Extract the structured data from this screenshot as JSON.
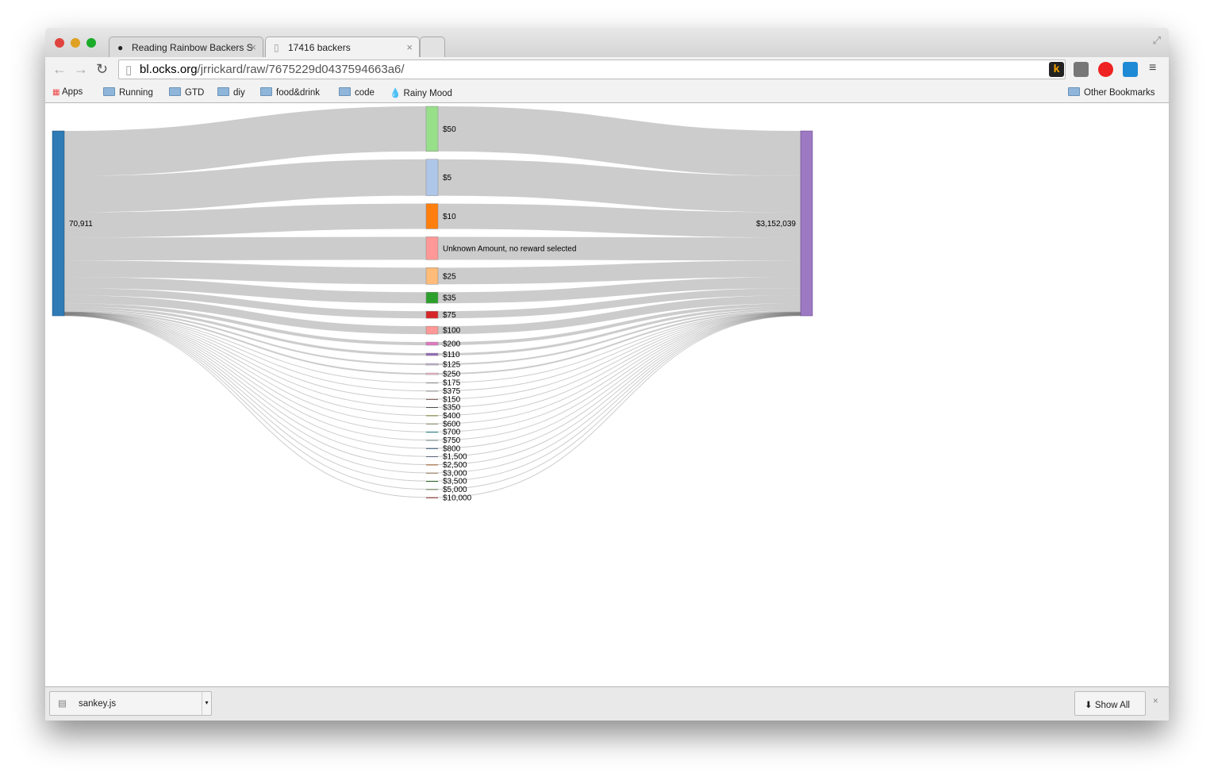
{
  "browser": {
    "tabs": [
      {
        "label": "Reading Rainbow Backers S",
        "icon": "github-icon"
      },
      {
        "label": "17416 backers",
        "icon": "page-icon"
      }
    ],
    "url_host": "bl.ocks.org",
    "url_path": "/jrrickard/raw/7675229d0437594663a6/",
    "bookmarks": [
      "Apps",
      "Running",
      "GTD",
      "diy",
      "food&drink",
      "code",
      "Rainy Mood"
    ],
    "other_bookmarks": "Other Bookmarks",
    "download": {
      "file": "sankey.js",
      "show_all": "Show All"
    }
  },
  "colors": {
    "link": "#cccccc",
    "source_node": "#2f7bb6",
    "target_node": "#9d79c3"
  },
  "chart_data": {
    "type": "sankey",
    "source": {
      "label": "70,911"
    },
    "target": {
      "label": "$3,152,039"
    },
    "nodes": [
      {
        "label": "$50",
        "value": 17270,
        "color": "#98df8a"
      },
      {
        "label": "$5",
        "value": 13940,
        "color": "#aec7e8"
      },
      {
        "label": "$10",
        "value": 9700,
        "color": "#ff7f0e"
      },
      {
        "label": "Unknown Amount, no reward selected",
        "value": 8790,
        "color": "#ff9896"
      },
      {
        "label": "$25",
        "value": 6360,
        "color": "#ffbb78"
      },
      {
        "label": "$35",
        "value": 4240,
        "color": "#2ca02c"
      },
      {
        "label": "$75",
        "value": 2730,
        "color": "#d62728"
      },
      {
        "label": "$100",
        "value": 3030,
        "color": "#ff9896"
      },
      {
        "label": "$200",
        "value": 1210,
        "color": "#e377c2"
      },
      {
        "label": "$110",
        "value": 910,
        "color": "#9467bd"
      },
      {
        "label": "$125",
        "value": 610,
        "color": "#c5b0d5"
      },
      {
        "label": "$250",
        "value": 610,
        "color": "#f7b6d2"
      },
      {
        "label": "$175",
        "value": 100,
        "color": "#7f7f7f"
      },
      {
        "label": "$375",
        "value": 100,
        "color": "#7f7f7f"
      },
      {
        "label": "$150",
        "value": 100,
        "color": "#5a3a30"
      },
      {
        "label": "$350",
        "value": 100,
        "color": "#444444"
      },
      {
        "label": "$400",
        "value": 100,
        "color": "#6b6b20"
      },
      {
        "label": "$600",
        "value": 100,
        "color": "#707050"
      },
      {
        "label": "$700",
        "value": 100,
        "color": "#0e6a70"
      },
      {
        "label": "$750",
        "value": 100,
        "color": "#5a7070"
      },
      {
        "label": "$800",
        "value": 100,
        "color": "#1a3a55"
      },
      {
        "label": "$1,500",
        "value": 100,
        "color": "#556070"
      },
      {
        "label": "$2,500",
        "value": 100,
        "color": "#8a4a1a"
      },
      {
        "label": "$3,000",
        "value": 100,
        "color": "#806040"
      },
      {
        "label": "$3,500",
        "value": 100,
        "color": "#1a5a1a"
      },
      {
        "label": "$5,000",
        "value": 100,
        "color": "#506a40"
      },
      {
        "label": "$10,000",
        "value": 100,
        "color": "#6a1010"
      }
    ]
  }
}
